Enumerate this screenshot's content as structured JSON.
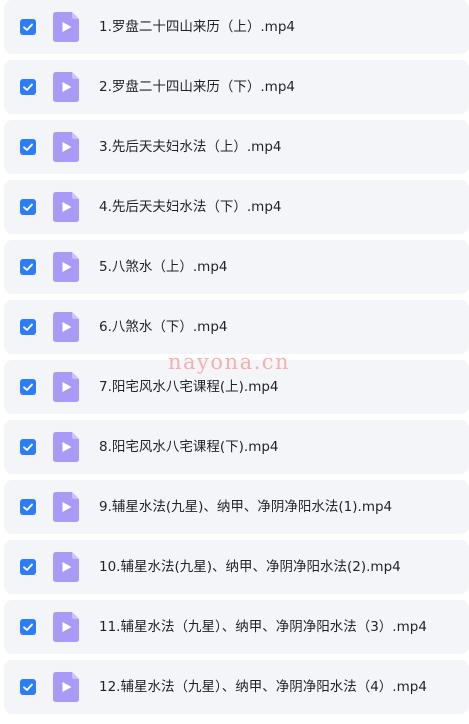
{
  "files": [
    {
      "name": "1.罗盘二十四山来历（上）.mp4",
      "checked": true
    },
    {
      "name": "2.罗盘二十四山来历（下）.mp4",
      "checked": true
    },
    {
      "name": "3.先后天夫妇水法（上）.mp4",
      "checked": true
    },
    {
      "name": "4.先后天夫妇水法（下）.mp4",
      "checked": true
    },
    {
      "name": "5.八煞水（上）.mp4",
      "checked": true
    },
    {
      "name": "6.八煞水（下）.mp4",
      "checked": true
    },
    {
      "name": "7.阳宅风水八宅课程(上).mp4",
      "checked": true
    },
    {
      "name": "8.阳宅风水八宅课程(下).mp4",
      "checked": true
    },
    {
      "name": "9.辅星水法(九星)、纳甲、净阴净阳水法(1).mp4",
      "checked": true
    },
    {
      "name": "10.辅星水法(九星)、纳甲、净阴净阳水法(2).mp4",
      "checked": true
    },
    {
      "name": "11.辅星水法（九星）、纳甲、净阴净阳水法（3）.mp4",
      "checked": true
    },
    {
      "name": "12.辅星水法（九星）、纳甲、净阴净阳水法（4）.mp4",
      "checked": true
    }
  ],
  "watermark": "nayona.cn",
  "colors": {
    "checkbox": "#2d7df6",
    "video_icon": "#a99bf5",
    "row_bg": "#f4f5f9"
  },
  "icons": {
    "checkbox": "checkmark-icon",
    "file": "video-file-icon"
  }
}
